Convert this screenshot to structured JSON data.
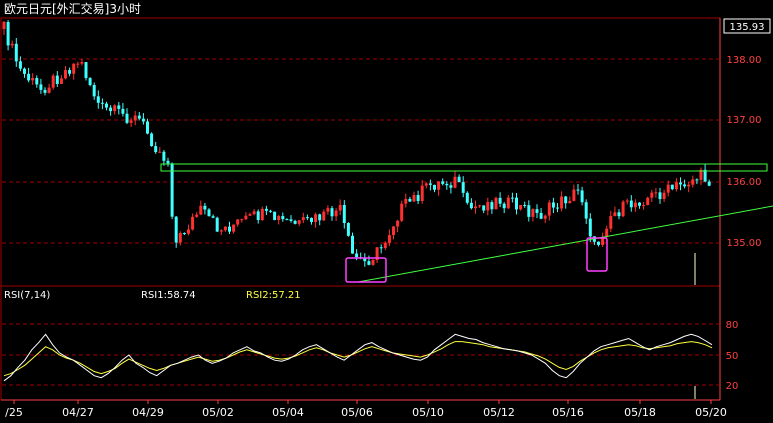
{
  "title": "欧元日元[外汇交易]3小时",
  "price_panel": {
    "current_price_box": "135.93",
    "price_ticks": [
      "138.00",
      "137.00",
      "136.00",
      "135.00"
    ]
  },
  "rsi_panel": {
    "label": "RSI(7,14)",
    "rsi1_label": "RSI1:58.74",
    "rsi2_label": "RSI2:57.21",
    "ticks": [
      "80",
      "50",
      "20"
    ]
  },
  "x_ticks": [
    "/25",
    "04/27",
    "04/29",
    "05/02",
    "05/04",
    "05/06",
    "05/10",
    "05/12",
    "05/16",
    "05/18",
    "05/20"
  ],
  "colors": {
    "background": "#000000",
    "up_candle": "#ff3030",
    "down_candle": "#40ffff",
    "grid": "#a00000",
    "axis": "#ff4040",
    "resistance_line": "#40ff40",
    "support_line": "#40ff40",
    "highlight_box": "#ff40ff",
    "rsi1": "#ffffff",
    "rsi2": "#ffff40",
    "title_text": "#ffffff",
    "label_text": "#ffff40"
  },
  "chart_data": {
    "type": "candlestick",
    "title": "欧元日元[外汇交易]3小时",
    "ylim": [
      134.45,
      136.05
    ],
    "rsi_ylim": [
      0,
      100
    ],
    "x_tick_labels": [
      "/25",
      "04/27",
      "04/29",
      "05/02",
      "05/04",
      "05/06",
      "05/10",
      "05/12",
      "05/16",
      "05/18",
      "05/20"
    ],
    "annotations": {
      "resistance_level": 136.22,
      "support_trendline": {
        "from_price": 134.6,
        "to_price": 135.58
      },
      "highlight_boxes": [
        "05/06",
        "05/16"
      ]
    },
    "series": [
      {
        "name": "RSI1",
        "values": [
          25,
          30,
          38,
          45,
          55,
          62,
          70,
          60,
          52,
          48,
          45,
          40,
          35,
          30,
          28,
          32,
          38,
          45,
          50,
          42,
          38,
          33,
          30,
          35,
          40,
          42,
          45,
          48,
          50,
          45,
          42,
          44,
          47,
          52,
          55,
          58,
          54,
          52,
          48,
          45,
          44,
          46,
          50,
          55,
          58,
          60,
          56,
          52,
          48,
          45,
          50,
          55,
          60,
          62,
          58,
          55,
          52,
          50,
          48,
          46,
          45,
          48,
          55,
          60,
          65,
          70,
          68,
          66,
          65,
          62,
          60,
          58,
          56,
          55,
          54,
          52,
          50,
          46,
          42,
          35,
          30,
          28,
          34,
          42,
          48,
          54,
          58,
          60,
          62,
          64,
          66,
          62,
          58,
          55,
          58,
          60,
          62,
          65,
          68,
          70,
          68,
          64,
          60
        ]
      },
      {
        "name": "RSI2",
        "values": [
          30,
          32,
          36,
          40,
          46,
          52,
          58,
          55,
          50,
          47,
          45,
          42,
          38,
          34,
          32,
          34,
          37,
          42,
          46,
          43,
          40,
          37,
          35,
          37,
          40,
          42,
          44,
          46,
          48,
          46,
          44,
          45,
          47,
          50,
          53,
          55,
          53,
          51,
          49,
          47,
          46,
          47,
          49,
          52,
          55,
          57,
          55,
          52,
          50,
          48,
          50,
          53,
          56,
          58,
          56,
          54,
          52,
          51,
          50,
          49,
          48,
          50,
          53,
          56,
          60,
          63,
          63,
          62,
          61,
          60,
          58,
          57,
          56,
          55,
          54,
          53,
          51,
          49,
          46,
          42,
          38,
          36,
          39,
          44,
          48,
          52,
          55,
          57,
          58,
          59,
          60,
          59,
          57,
          56,
          57,
          58,
          59,
          61,
          62,
          63,
          62,
          60,
          57
        ]
      }
    ]
  }
}
